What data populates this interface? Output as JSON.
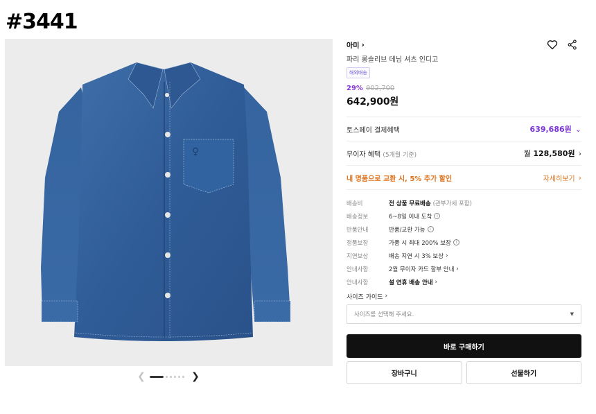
{
  "overlay_tag": "#3441",
  "product": {
    "brand": "아미",
    "name": "파리 롱슬리브 데님 셔츠 인디고",
    "badge": "해외배송",
    "discount": "29%",
    "original_price": "902,700",
    "price": "642,900원"
  },
  "gallery": {
    "total_images": 6,
    "current_index": 1
  },
  "icons": {
    "brand_chevron": "chevron-right-icon",
    "wishlist": "heart-icon",
    "share": "share-icon"
  },
  "benefits": {
    "toss_label": "토스페이 결제혜택",
    "toss_value": "639,686원",
    "installment_label": "무이자 혜택",
    "installment_sub": "(5개월 기준)",
    "installment_prefix": "월",
    "installment_value": "128,580원",
    "exchange_label": "내 명품으로 교환 시, 5% 추가 할인",
    "exchange_link": "자세히보기"
  },
  "shipping_info": [
    {
      "key": "배송비",
      "value": "전 상품 무료배송",
      "sub": "(관부가세 포함)",
      "bold": true,
      "icon": "",
      "chevron": false
    },
    {
      "key": "배송정보",
      "value": "6~8일 이내 도착",
      "sub": "",
      "bold": false,
      "icon": "info-icon",
      "chevron": false
    },
    {
      "key": "반품안내",
      "value": "반품/교환 가능",
      "sub": "",
      "bold": false,
      "icon": "info-icon",
      "chevron": false
    },
    {
      "key": "정품보장",
      "value": "가품 시 최대 200% 보장",
      "sub": "",
      "bold": false,
      "icon": "info-icon",
      "chevron": false
    },
    {
      "key": "지연보상",
      "value": "배송 지연 시 3% 보상",
      "sub": "",
      "bold": false,
      "icon": "",
      "chevron": true
    },
    {
      "key": "안내사항",
      "value": "2월 무이자 카드 할부 안내",
      "sub": "",
      "bold": false,
      "icon": "",
      "chevron": true
    },
    {
      "key": "안내사항",
      "value": "설 연휴 배송 안내",
      "sub": "",
      "bold": true,
      "icon": "",
      "chevron": true
    }
  ],
  "size": {
    "guide_label": "사이즈 가이드",
    "placeholder": "사이즈를 선택해 주세요."
  },
  "actions": {
    "buy_now": "바로 구매하기",
    "cart": "장바구니",
    "gift": "선물하기"
  },
  "colors": {
    "accent_purple": "#7b35d4",
    "accent_orange": "#e0731c",
    "denim": "#2d5b9a"
  }
}
